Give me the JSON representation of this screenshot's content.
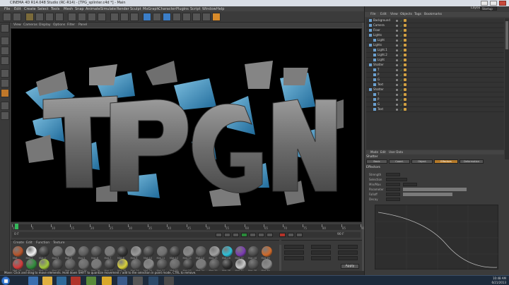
{
  "window": {
    "title": "CINEMA 4D R14.048 Studio (RC-R14) - [TPG_splinter.c4d *] - Main"
  },
  "menubar": {
    "items": [
      "File",
      "Edit",
      "Create",
      "Select",
      "Tools",
      "Mesh",
      "Snap",
      "Animate",
      "Simulate",
      "Render",
      "Sculpt",
      "MoGraph",
      "Character",
      "Plugins",
      "Script",
      "Window",
      "Help"
    ]
  },
  "viewport": {
    "menu": [
      "View",
      "Cameras",
      "Display",
      "Options",
      "Filter",
      "Panel"
    ],
    "scene_text": "TPG"
  },
  "timeline": {
    "ruler_labels": [
      "0",
      "5",
      "10",
      "15",
      "20",
      "25",
      "30",
      "35",
      "40",
      "45",
      "50",
      "55",
      "60",
      "65",
      "70",
      "75",
      "80",
      "85",
      "90"
    ],
    "current_frame": "0 F",
    "end_frame": "90 F"
  },
  "materials": {
    "menu": [
      "Create",
      "Edit",
      "Function",
      "Texture"
    ],
    "swatches_row1": [
      {
        "name": "Mat",
        "color": "#b5532a"
      },
      {
        "name": "Mat.1",
        "color": "#f2f2f2"
      },
      {
        "name": "Mat.2",
        "color": "#3a3a3a"
      },
      {
        "name": "Mat.3",
        "color": "#6b6b6b"
      },
      {
        "name": "Mat.4",
        "color": "#8a8a8a"
      },
      {
        "name": "Mat.5",
        "color": "#5a5a5a"
      },
      {
        "name": "Mat.6",
        "color": "#4e4e4e"
      },
      {
        "name": "Mat.7",
        "color": "#777777"
      },
      {
        "name": "Mat.8",
        "color": "#2f2f2f"
      },
      {
        "name": "Mat.9",
        "color": "#999999"
      },
      {
        "name": "Mat.10",
        "color": "#444444"
      },
      {
        "name": "Mat.11",
        "color": "#6e6e6e"
      },
      {
        "name": "Mat.12",
        "color": "#3c3c3c"
      },
      {
        "name": "Mat.13",
        "color": "#888888"
      },
      {
        "name": "Mat.14",
        "color": "#555555"
      },
      {
        "name": "Mat.15",
        "color": "#a0a0a0"
      },
      {
        "name": "Mat.16",
        "color": "#2bc0d8"
      },
      {
        "name": "Mat.17",
        "color": "#7a3bb0"
      },
      {
        "name": "Mat.18",
        "color": "#4a4a4a"
      },
      {
        "name": "Mat.19",
        "color": "#d06a2a"
      }
    ],
    "swatches_row2": [
      {
        "name": "Mat.20",
        "color": "#d23a3a"
      },
      {
        "name": "Mat.21",
        "color": "#2f8a3a"
      },
      {
        "name": "Mat.22",
        "color": "#a0c83a"
      },
      {
        "name": "Mat.23",
        "color": "#444444"
      },
      {
        "name": "Mat.24",
        "color": "#5a5a5a"
      },
      {
        "name": "Mat.25",
        "color": "#6a6a6a"
      },
      {
        "name": "Mat.26",
        "color": "#777777"
      },
      {
        "name": "Mat.27",
        "color": "#3e3e3e"
      },
      {
        "name": "Mat.28",
        "color": "#d8d03a"
      },
      {
        "name": "Mat.29",
        "color": "#555555"
      },
      {
        "name": "Mat.30",
        "color": "#888888"
      },
      {
        "name": "Mat.31",
        "color": "#4b4b4b"
      },
      {
        "name": "Mat.32",
        "color": "#666666"
      },
      {
        "name": "Mat.33",
        "color": "#3a3a3a"
      },
      {
        "name": "Mat.34",
        "color": "#7a7a7a"
      },
      {
        "name": "Mat.35",
        "color": "#505050"
      },
      {
        "name": "Mat.36",
        "color": "#2a2a2a"
      },
      {
        "name": "Mat.37",
        "color": "#c9c9c9"
      },
      {
        "name": "Mat.38",
        "color": "#4c4c4c"
      },
      {
        "name": "Mat.39",
        "color": "#8c8c8c"
      }
    ]
  },
  "coordinates": {
    "apply_label": "Apply"
  },
  "status": {
    "text": "Move: Click and drag to move elements. Hold down SHIFT to quantize movement / add to the selection in point mode, CTRL to remove."
  },
  "right_panel": {
    "layout_label": "Layout:",
    "layout_value": "Startup",
    "menu": [
      "File",
      "Edit",
      "View",
      "Objects",
      "Tags",
      "Bookmarks"
    ],
    "objects": [
      {
        "name": "Background",
        "indent": 0
      },
      {
        "name": "Camera",
        "indent": 0
      },
      {
        "name": "Floor",
        "indent": 0
      },
      {
        "name": "Lights",
        "indent": 0
      },
      {
        "name": "Light",
        "indent": 1
      },
      {
        "name": "Lights",
        "indent": 0
      },
      {
        "name": "Light.1",
        "indent": 1
      },
      {
        "name": "Light.2",
        "indent": 1
      },
      {
        "name": "Light",
        "indent": 1
      },
      {
        "name": "Shatter",
        "indent": 0
      },
      {
        "name": "T",
        "indent": 1
      },
      {
        "name": "P",
        "indent": 1
      },
      {
        "name": "G",
        "indent": 1
      },
      {
        "name": "Text",
        "indent": 1
      },
      {
        "name": "Shatter",
        "indent": 0
      },
      {
        "name": "T",
        "indent": 1
      },
      {
        "name": "P",
        "indent": 1
      },
      {
        "name": "G",
        "indent": 1
      },
      {
        "name": "Text",
        "indent": 1
      }
    ],
    "attr_menu": [
      "Mode",
      "Edit",
      "User Data"
    ],
    "attr_object": "Shatter",
    "attr_tabs": [
      "Basic",
      "Coord.",
      "Object",
      "Effectors",
      "Deformation"
    ],
    "attr_active_tab": "Effectors",
    "attr_section": "Effectors",
    "attr_rows": [
      "Strength",
      "Selection",
      "Min/Max",
      "Parameter",
      "Falloff",
      "Decay"
    ]
  },
  "taskbar": {
    "time": "10:48 AM",
    "date": "6/21/2013"
  }
}
